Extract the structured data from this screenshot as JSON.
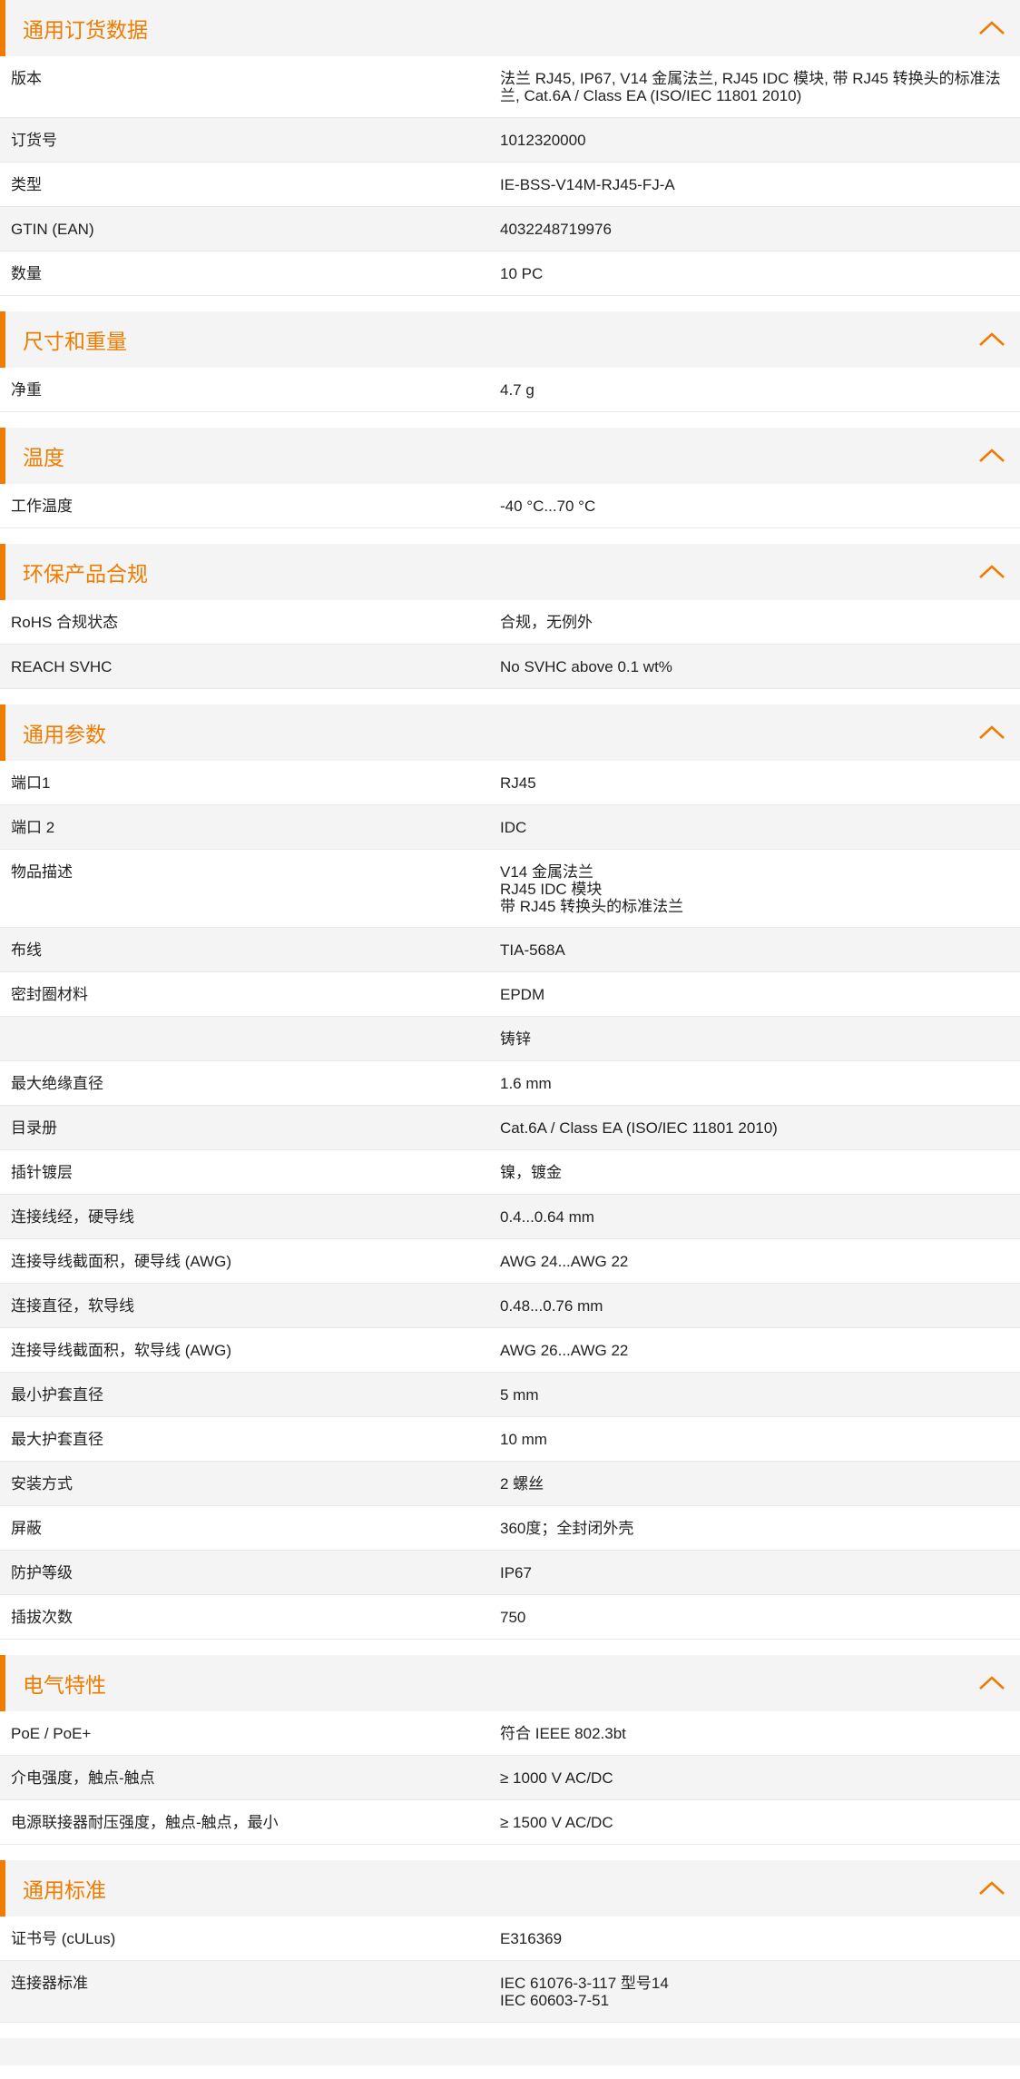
{
  "sections": [
    {
      "title": "通用订货数据",
      "rows": [
        {
          "label": "版本",
          "value": "法兰 RJ45, IP67, V14 金属法兰, RJ45 IDC 模块, 带 RJ45 转换头的标准法\n兰, Cat.6A / Class EA (ISO/IEC 11801 2010)"
        },
        {
          "label": "订货号",
          "value": "1012320000"
        },
        {
          "label": "类型",
          "value": "IE-BSS-V14M-RJ45-FJ-A"
        },
        {
          "label": "GTIN (EAN)",
          "value": "4032248719976"
        },
        {
          "label": "数量",
          "value": "10  PC"
        }
      ]
    },
    {
      "title": "尺寸和重量",
      "rows": [
        {
          "label": "净重",
          "value": "4.7  g"
        }
      ]
    },
    {
      "title": "温度",
      "rows": [
        {
          "label": "工作温度",
          "value": "-40 °C...70 °C"
        }
      ]
    },
    {
      "title": "环保产品合规",
      "rows": [
        {
          "label": "RoHS 合规状态",
          "value": "合规，无例外"
        },
        {
          "label": "REACH SVHC",
          "value": "No SVHC above 0.1 wt%"
        }
      ]
    },
    {
      "title": "通用参数",
      "rows": [
        {
          "label": "端口1",
          "value": "RJ45"
        },
        {
          "label": "端口 2",
          "value": "IDC"
        },
        {
          "label": "物品描述",
          "value": "V14 金属法兰\nRJ45 IDC 模块\n带 RJ45 转换头的标准法兰"
        },
        {
          "label": "布线",
          "value": "TIA-568A"
        },
        {
          "label": "密封圈材料",
          "value": "EPDM"
        },
        {
          "label": "",
          "value": "铸锌"
        },
        {
          "label": "最大绝缘直径",
          "value": "1.6  mm"
        },
        {
          "label": "目录册",
          "value": "Cat.6A / Class EA (ISO/IEC 11801 2010)"
        },
        {
          "label": "插针镀层",
          "value": "镍，镀金"
        },
        {
          "label": "连接线经，硬导线",
          "value": "0.4...0.64 mm"
        },
        {
          "label": "连接导线截面积，硬导线 (AWG)",
          "value": "AWG 24...AWG 22"
        },
        {
          "label": "连接直径，软导线",
          "value": "0.48...0.76 mm"
        },
        {
          "label": "连接导线截面积，软导线 (AWG)",
          "value": "AWG 26...AWG 22"
        },
        {
          "label": "最小护套直径",
          "value": "5  mm"
        },
        {
          "label": "最大护套直径",
          "value": "10  mm"
        },
        {
          "label": "安装方式",
          "value": "2 螺丝"
        },
        {
          "label": "屏蔽",
          "value": "360度；全封闭外壳"
        },
        {
          "label": "防护等级",
          "value": "IP67"
        },
        {
          "label": "插拔次数",
          "value": "750"
        }
      ]
    },
    {
      "title": "电气特性",
      "rows": [
        {
          "label": "PoE / PoE+",
          "value": "符合 IEEE 802.3bt"
        },
        {
          "label": "介电强度，触点-触点",
          "value": "≥ 1000 V AC/DC"
        },
        {
          "label": "电源联接器耐压强度，触点-触点，最小",
          "value": "≥ 1500 V AC/DC"
        }
      ]
    },
    {
      "title": "通用标准",
      "rows": [
        {
          "label": "证书号 (cULus)",
          "value": "E316369"
        },
        {
          "label": "连接器标准",
          "value": "IEC 61076-3-117 型号14\nIEC 60603-7-51"
        }
      ]
    }
  ],
  "icons": {
    "collapse": "chevron-up-icon"
  },
  "colors": {
    "accent": "#ef7c00",
    "stripe": "#f4f4f4",
    "text": "#222222"
  }
}
